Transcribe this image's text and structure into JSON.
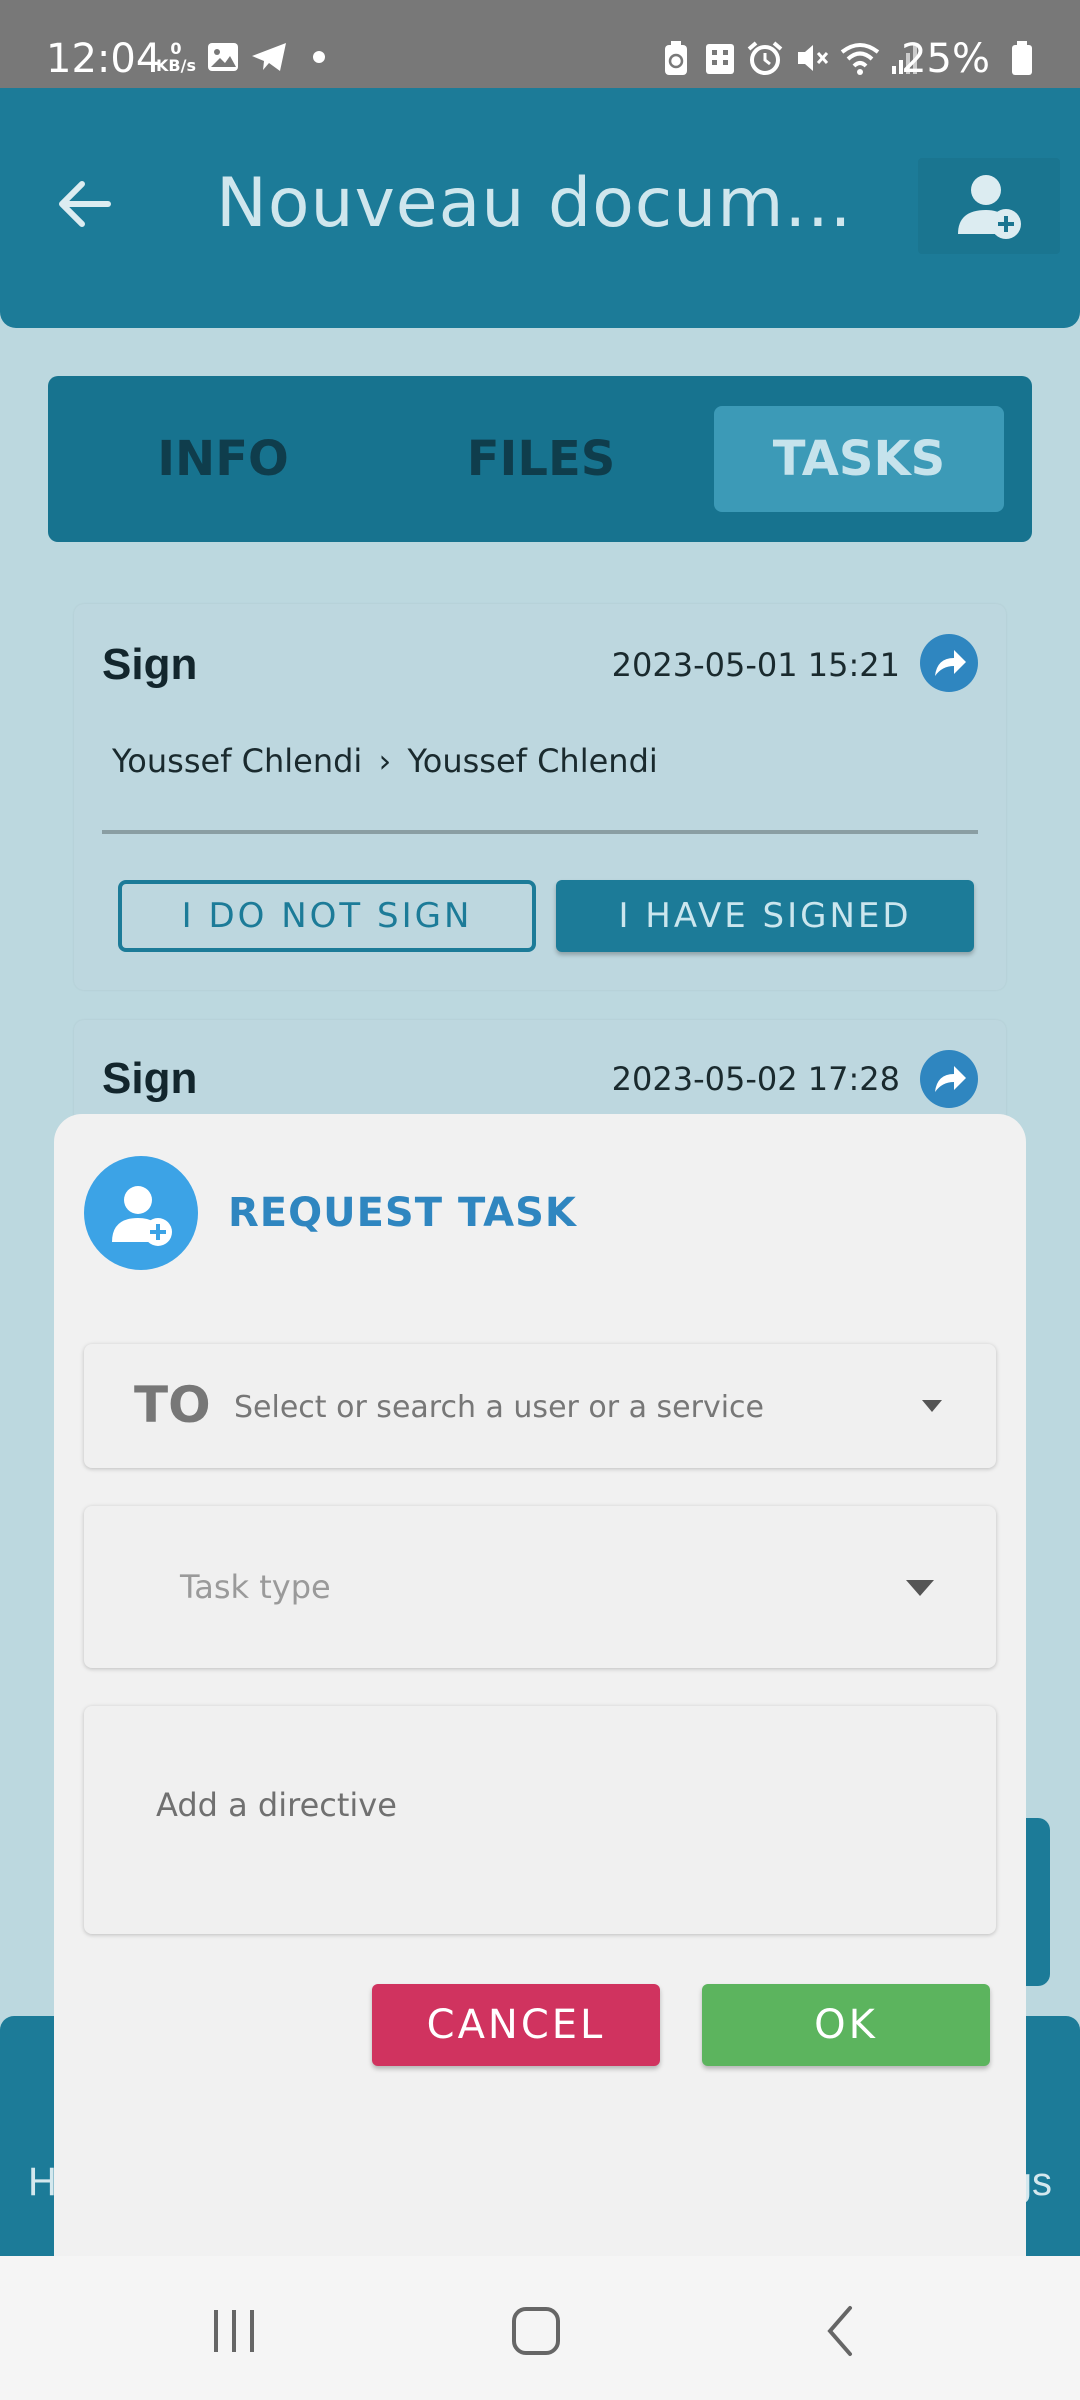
{
  "status_bar": {
    "time": "12:04",
    "net_speed_value": "0",
    "net_speed_unit": "KB/s",
    "battery": "25%",
    "icons": [
      "image-icon",
      "telegram-icon",
      "dot-icon",
      "battery-saver-icon",
      "building-icon",
      "alarm-icon",
      "mute-icon",
      "wifi-icon",
      "signal-icon",
      "battery-icon"
    ]
  },
  "header": {
    "title": "Nouveau docum...",
    "back_icon": "arrow-left-icon",
    "action_icon": "add-user-icon"
  },
  "tabs": [
    {
      "label": "INFO",
      "active": false
    },
    {
      "label": "FILES",
      "active": false
    },
    {
      "label": "TASKS",
      "active": true
    }
  ],
  "tasks": [
    {
      "type": "Sign",
      "datetime": "2023-05-01 15:21",
      "from": "Youssef Chlendi",
      "to": "Youssef Chlendi",
      "decline_label": "I DO NOT SIGN",
      "confirm_label": "I HAVE SIGNED"
    },
    {
      "type": "Sign",
      "datetime": "2023-05-02 17:28"
    }
  ],
  "bottom_nav_peek": {
    "left_text": "H",
    "right_text": "gs"
  },
  "dialog": {
    "title": "REQUEST TASK",
    "to_label": "TO",
    "to_placeholder": "Select or search a user or a service",
    "task_type_placeholder": "Task type",
    "directive_placeholder": "Add a directive",
    "cancel_label": "CANCEL",
    "ok_label": "OK"
  },
  "colors": {
    "primary": "#1c7b98",
    "accent_blue": "#2f86c0",
    "cancel": "#d0335f",
    "ok": "#5cb45e"
  }
}
